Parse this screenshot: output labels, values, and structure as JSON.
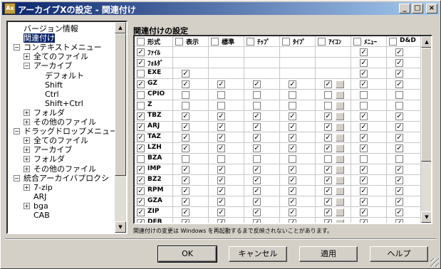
{
  "window": {
    "title": "アーカイブXの設定 - 関連付け",
    "icon_label": "Ax"
  },
  "titlebar_buttons": {
    "minimize": "_",
    "maximize": "□",
    "close": "×"
  },
  "tree": {
    "items": [
      {
        "label": "バージョン情報",
        "level": 0,
        "expander": ""
      },
      {
        "label": "関連付け",
        "level": 0,
        "expander": "",
        "selected": true
      },
      {
        "label": "コンテキストメニュー",
        "level": 0,
        "expander": "−"
      },
      {
        "label": "全てのファイル",
        "level": 1,
        "expander": "+"
      },
      {
        "label": "アーカイブ",
        "level": 1,
        "expander": "−"
      },
      {
        "label": "デフォルト",
        "level": 2,
        "expander": ""
      },
      {
        "label": "Shift",
        "level": 2,
        "expander": ""
      },
      {
        "label": "Ctrl",
        "level": 2,
        "expander": ""
      },
      {
        "label": "Shift+Ctrl",
        "level": 2,
        "expander": ""
      },
      {
        "label": "フォルダ",
        "level": 1,
        "expander": "+"
      },
      {
        "label": "その他のファイル",
        "level": 1,
        "expander": "+"
      },
      {
        "label": "ドラッグドロップメニュー",
        "level": 0,
        "expander": "−"
      },
      {
        "label": "全てのファイル",
        "level": 1,
        "expander": "+"
      },
      {
        "label": "アーカイブ",
        "level": 1,
        "expander": "+"
      },
      {
        "label": "フォルダ",
        "level": 1,
        "expander": "+"
      },
      {
        "label": "その他のファイル",
        "level": 1,
        "expander": "+"
      },
      {
        "label": "統合アーカイバプロクシ",
        "level": 0,
        "expander": "−"
      },
      {
        "label": "7-zip",
        "level": 1,
        "expander": "+"
      },
      {
        "label": "ARJ",
        "level": 1,
        "expander": ""
      },
      {
        "label": "bga",
        "level": 1,
        "expander": "+"
      },
      {
        "label": "CAB",
        "level": 1,
        "expander": ""
      }
    ]
  },
  "section_title": "関連付けの設定",
  "columns": [
    "形式",
    "表示",
    "標準",
    "ﾁｯﾌﾟ",
    "ﾀｲﾌﾟ",
    "ｱｲｺﾝ",
    "ﾒﾆｭｰ",
    "D&D"
  ],
  "rows": [
    {
      "ext": "ﾌｧｲﾙ",
      "checked": true,
      "cells": [
        null,
        null,
        null,
        null,
        null,
        true,
        true
      ]
    },
    {
      "ext": "ﾌｫﾙﾀﾞ",
      "checked": true,
      "cells": [
        null,
        null,
        null,
        null,
        null,
        true,
        true
      ]
    },
    {
      "ext": "EXE",
      "checked": false,
      "cells": [
        true,
        null,
        null,
        null,
        null,
        true,
        true
      ]
    },
    {
      "ext": "GZ",
      "checked": true,
      "cells": [
        true,
        true,
        true,
        true,
        true,
        true,
        true
      ]
    },
    {
      "ext": "CPIO",
      "checked": false,
      "cells": [
        false,
        false,
        false,
        false,
        false,
        false,
        false
      ]
    },
    {
      "ext": "Z",
      "checked": false,
      "cells": [
        false,
        false,
        false,
        false,
        false,
        false,
        false
      ]
    },
    {
      "ext": "TBZ",
      "checked": true,
      "cells": [
        true,
        true,
        true,
        true,
        true,
        true,
        true
      ]
    },
    {
      "ext": "ARJ",
      "checked": true,
      "cells": [
        true,
        true,
        true,
        true,
        true,
        true,
        true
      ]
    },
    {
      "ext": "TAZ",
      "checked": true,
      "cells": [
        true,
        true,
        true,
        true,
        true,
        true,
        true
      ]
    },
    {
      "ext": "LZH",
      "checked": true,
      "cells": [
        true,
        true,
        true,
        true,
        true,
        true,
        true
      ]
    },
    {
      "ext": "BZA",
      "checked": false,
      "cells": [
        false,
        false,
        false,
        false,
        false,
        false,
        false
      ]
    },
    {
      "ext": "IMP",
      "checked": true,
      "cells": [
        true,
        true,
        true,
        true,
        true,
        true,
        true
      ]
    },
    {
      "ext": "BZ2",
      "checked": true,
      "cells": [
        true,
        true,
        true,
        true,
        true,
        true,
        true
      ]
    },
    {
      "ext": "RPM",
      "checked": true,
      "cells": [
        true,
        true,
        true,
        true,
        true,
        true,
        true
      ]
    },
    {
      "ext": "GZA",
      "checked": true,
      "cells": [
        true,
        true,
        true,
        true,
        true,
        true,
        true
      ]
    },
    {
      "ext": "ZIP",
      "checked": true,
      "cells": [
        true,
        true,
        true,
        true,
        true,
        true,
        true
      ]
    },
    {
      "ext": "DEB",
      "checked": true,
      "cells": [
        true,
        true,
        true,
        true,
        true,
        true,
        true
      ]
    }
  ],
  "note": "関連付けの変更は Windows を再起動するまで反映されないことがあります。",
  "buttons": {
    "ok": "OK",
    "cancel": "キャンセル",
    "apply": "適用",
    "help": "ヘルプ"
  },
  "scroll_arrows": {
    "up": "▲",
    "down": "▼"
  },
  "check_mark": "✓",
  "colors": {
    "title_start": "#0a246a",
    "title_end": "#a6caf0",
    "face": "#d4d0c8",
    "selection": "#0a246a"
  }
}
